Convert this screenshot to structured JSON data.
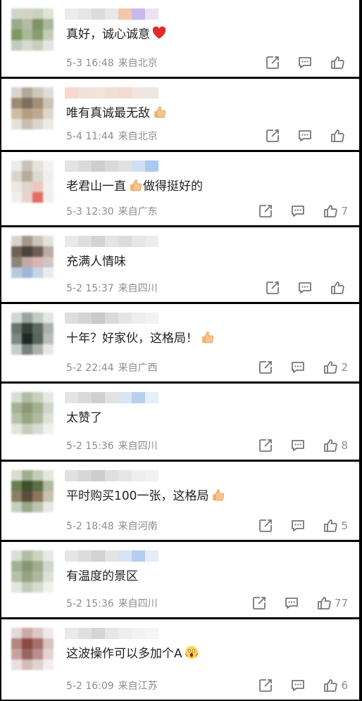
{
  "colors": {
    "muted": "#8c8c8c",
    "text": "#222222",
    "divider": "#000000"
  },
  "comments": [
    {
      "text": "真好，诚心诚意",
      "emoji": "red-heart",
      "date": "5-3 16:48",
      "location": "来自北京",
      "likes": "",
      "avatar": [
        "#cfd6c8",
        "#d8d2c5",
        "#c8d0bf",
        "#dfe2d7",
        "#9aaa8a",
        "#b5bba1",
        "#7e9463",
        "#a9b79a",
        "#7d9a61",
        "#a8b996",
        "#889d6f",
        "#c3ccb5",
        "#c4c9bd",
        "#d5d9cf",
        "#c8cdbf",
        "#e3e5de"
      ],
      "name": [
        "#ececec",
        "#e6e6e6",
        "#dcdcdc",
        "#e8e8e8",
        "#f3c8a8",
        "#c9b8ef",
        "#e8e2f3"
      ]
    },
    {
      "text": "唯有真诚最无敌",
      "emoji": "thumbs-up",
      "date": "5-4 11:44",
      "location": "来自北京",
      "likes": "",
      "avatar": [
        "#d9d4cc",
        "#b3a99a",
        "#d0c8bb",
        "#e0ddd7",
        "#9d8c75",
        "#7b6f60",
        "#a38e76",
        "#c9c2b7",
        "#cdbca3",
        "#b59f82",
        "#bda98e",
        "#ddd6cb",
        "#e4e0da",
        "#c8beb0",
        "#dcd5cb",
        "#eceae6"
      ],
      "name": [
        "#f6d8d0",
        "#f2e1da",
        "#f4e4d8",
        "#eee0d6",
        "#f3dccf",
        "#f0e6df",
        "#ede6e1"
      ]
    },
    {
      "text": "老君山一直",
      "text2": "做得挺好的",
      "emoji": "thumbs-up",
      "date": "5-3 12:30",
      "location": "来自广东",
      "likes": "7",
      "avatar": [
        "#ecebea",
        "#c8c2ba",
        "#e5e3e0",
        "#f2f2f1",
        "#d9d3cc",
        "#b8ab9c",
        "#ddd8d2",
        "#f0efee",
        "#ece8e4",
        "#e0d4cc",
        "#eec6be",
        "#f3f0ee",
        "#f1efed",
        "#e8d2cd",
        "#e36c65",
        "#f3efee"
      ],
      "name": [
        "#e3e3e3",
        "#dadada",
        "#cfcfcf",
        "#d9d9d9",
        "#e1e1e1",
        "#cfe0f5",
        "#a9c9ef"
      ]
    },
    {
      "text": "充满人情味",
      "emoji": "",
      "date": "5-2 15:37",
      "location": "来自四川",
      "likes": "",
      "avatar": [
        "#d8d3cf",
        "#a59889",
        "#cdc3b8",
        "#e5e1dd",
        "#6e6254",
        "#4c433a",
        "#6c5f55",
        "#b8aca3",
        "#8e8378",
        "#c4a9a7",
        "#dab6b3",
        "#cfc5c0",
        "#b8c9dd",
        "#9fb8d6",
        "#c7d4e3",
        "#e9ecef"
      ],
      "name": [
        "#e9e9e9",
        "#dedede",
        "#d3d3d3",
        "#e4e4e4",
        "#dcdcdc",
        "#e6e6e6",
        "#ececec"
      ]
    },
    {
      "text": "十年？好家伙，这格局！",
      "emoji": "thumbs-up",
      "date": "5-2 22:44",
      "location": "来自广西",
      "likes": "2",
      "avatar": [
        "#d2d6d2",
        "#9aa39c",
        "#c3c9c3",
        "#e3e5e3",
        "#6a7670",
        "#35403a",
        "#5c6a62",
        "#a9b2ac",
        "#7d8983",
        "#1f2824",
        "#59645e",
        "#b7beb9",
        "#c6ccc8",
        "#78817c",
        "#aab2ad",
        "#e6e8e7"
      ],
      "name": [
        "#dedede",
        "#d4d4d4",
        "#cacaca",
        "#dadada",
        "#e5e5e5",
        "#eeeeee",
        "#f2f2f2"
      ]
    },
    {
      "text": "太赞了",
      "emoji": "",
      "date": "5-2 15:36",
      "location": "来自四川",
      "likes": "8",
      "avatar": [
        "#d9ddd3",
        "#b3bda6",
        "#c9d0bf",
        "#e6e9e2",
        "#a6b295",
        "#8a9a76",
        "#a3af91",
        "#cfd5c7",
        "#b7c1a9",
        "#98a684",
        "#b0ba9f",
        "#dde1d7",
        "#e2e5de",
        "#c6cdbb",
        "#d8dcd1",
        "#eff1ec"
      ],
      "name": [
        "#e4e4e4",
        "#dadada",
        "#d0d0d0",
        "#e2e2e2",
        "#d9e5f3",
        "#b9d1f0",
        "#e6eef8"
      ]
    },
    {
      "text": "平时购买100一张，这格局",
      "emoji": "thumbs-up",
      "date": "5-2 18:48",
      "location": "来自河南",
      "likes": "5",
      "avatar": [
        "#d8dccf",
        "#9fae8b",
        "#c3ccb4",
        "#e3e6dd",
        "#6a7f52",
        "#3e4f2c",
        "#5d6f46",
        "#aebb9c",
        "#8a7f66",
        "#5c4c3a",
        "#8d765c",
        "#c8c0b0",
        "#c8cfc0",
        "#9aa98a",
        "#bcc5b1",
        "#e6e9e2"
      ],
      "name": [
        "#e1e1e1",
        "#d7d7d7",
        "#cdcdcd",
        "#dfdfdf",
        "#e6e6e6",
        "#eeeeee",
        "#f1f1f1"
      ]
    },
    {
      "text": "有温度的景区",
      "emoji": "",
      "date": "5-2 15:36",
      "location": "来自四川",
      "likes": "77",
      "avatar": [
        "#dadfd4",
        "#b2bda5",
        "#cad2c0",
        "#e7eae3",
        "#a4b093",
        "#869873",
        "#a1ad8f",
        "#d0d6c8",
        "#b6c0a8",
        "#95a381",
        "#aeb89d",
        "#dce0d6",
        "#e3e6df",
        "#c5ccba",
        "#d7dbd0",
        "#f0f2ed"
      ],
      "name": [
        "#e6e6e6",
        "#dcdcdc",
        "#d2d2d2",
        "#e3e3e3",
        "#d5e3f4",
        "#b4cdf0",
        "#e5edf8"
      ]
    },
    {
      "text": "这波操作可以多加个A",
      "emoji": "scream",
      "date": "5-2 16:09",
      "location": "来自江苏",
      "likes": "6",
      "avatar": [
        "#e3d9d8",
        "#c9aaa6",
        "#dcc8c5",
        "#efe9e8",
        "#b38681",
        "#8c4a45",
        "#a6706a",
        "#d9c2bf",
        "#c6a3a0",
        "#9a6560",
        "#b98f8b",
        "#e3d3d1",
        "#e8e0df",
        "#d3bdba",
        "#e0d2d0",
        "#f2eeed"
      ],
      "name": [
        "#e9e9e9",
        "#dfdfdf",
        "#d5d5d5",
        "#e6e6e6",
        "#eeeeee",
        "#f2f2f2",
        "#f5f5f5"
      ]
    }
  ],
  "actions": {
    "share_icon": "share-icon",
    "reply_icon": "reply-icon",
    "like_icon": "like-icon"
  }
}
